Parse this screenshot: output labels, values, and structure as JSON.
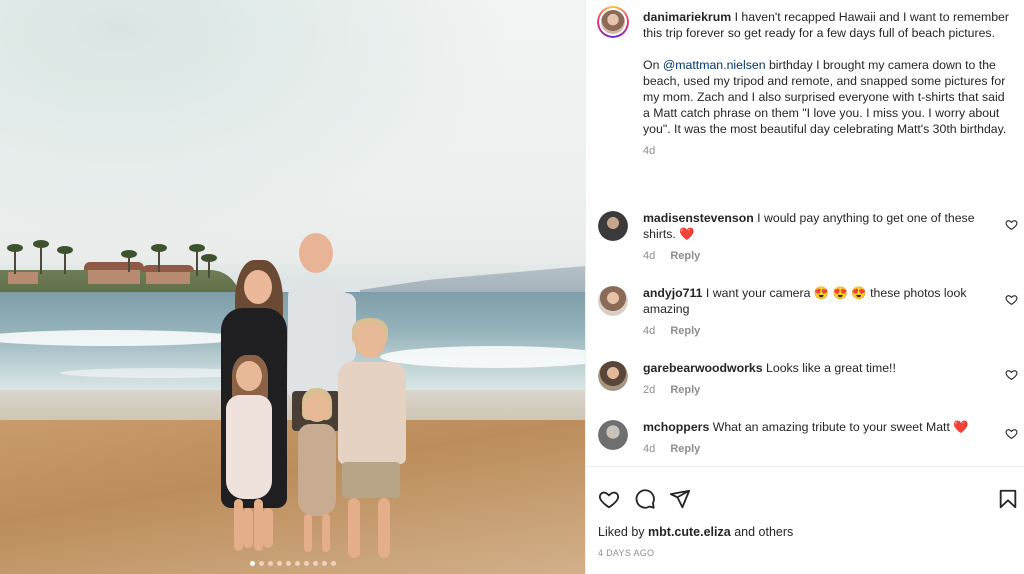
{
  "post": {
    "author": "danimariekrum",
    "caption_intro": "I haven't recapped Hawaii and I want to remember this trip forever so get ready for a few days full of beach pictures.",
    "caption_on": "On",
    "mention": "@mattman.nielsen",
    "caption_body": "birthday I brought my camera down to the beach, used my tripod and remote, and snapped some pictures for my mom. Zach and I also surprised everyone with t-shirts that said a Matt catch phrase on them \"I love you. I miss you. I worry about you\". It was the most beautiful day celebrating Matt's 30th birthday.",
    "caption_time": "4d",
    "carousel": {
      "slides": 10,
      "active_index": 0
    }
  },
  "comments": [
    {
      "username": "madisenstevenson",
      "text": "I would pay anything to get one of these shirts.",
      "emoji": "❤️",
      "time": "4d",
      "reply": "Reply",
      "avatar_color": "#3b3b3b"
    },
    {
      "username": "andyjo711",
      "text": "I want your camera",
      "emoji": "😍 😍 😍",
      "text_after": "these photos look amazing",
      "time": "4d",
      "reply": "Reply",
      "avatar_color": "#8a6b57"
    },
    {
      "username": "garebearwoodworks",
      "text": "Looks like a great time!!",
      "emoji": "",
      "time": "2d",
      "reply": "Reply",
      "avatar_color": "#5a4638"
    },
    {
      "username": "mchoppers",
      "text": "What an amazing tribute to your sweet Matt",
      "emoji": "❤️",
      "time": "4d",
      "reply": "Reply",
      "avatar_color": "#6f6f6f"
    }
  ],
  "actions": {
    "like_icon": "heart-icon",
    "comment_icon": "comment-icon",
    "share_icon": "share-icon",
    "save_icon": "bookmark-icon"
  },
  "likes": {
    "prefix": "Liked by",
    "user": "mbt.cute.eliza",
    "suffix": "and others"
  },
  "posted_ago": "4 DAYS AGO",
  "colors": {
    "heart_red": "#ed4956",
    "link_blue": "#00376b",
    "muted": "#8e8e8e",
    "text": "#262626"
  }
}
